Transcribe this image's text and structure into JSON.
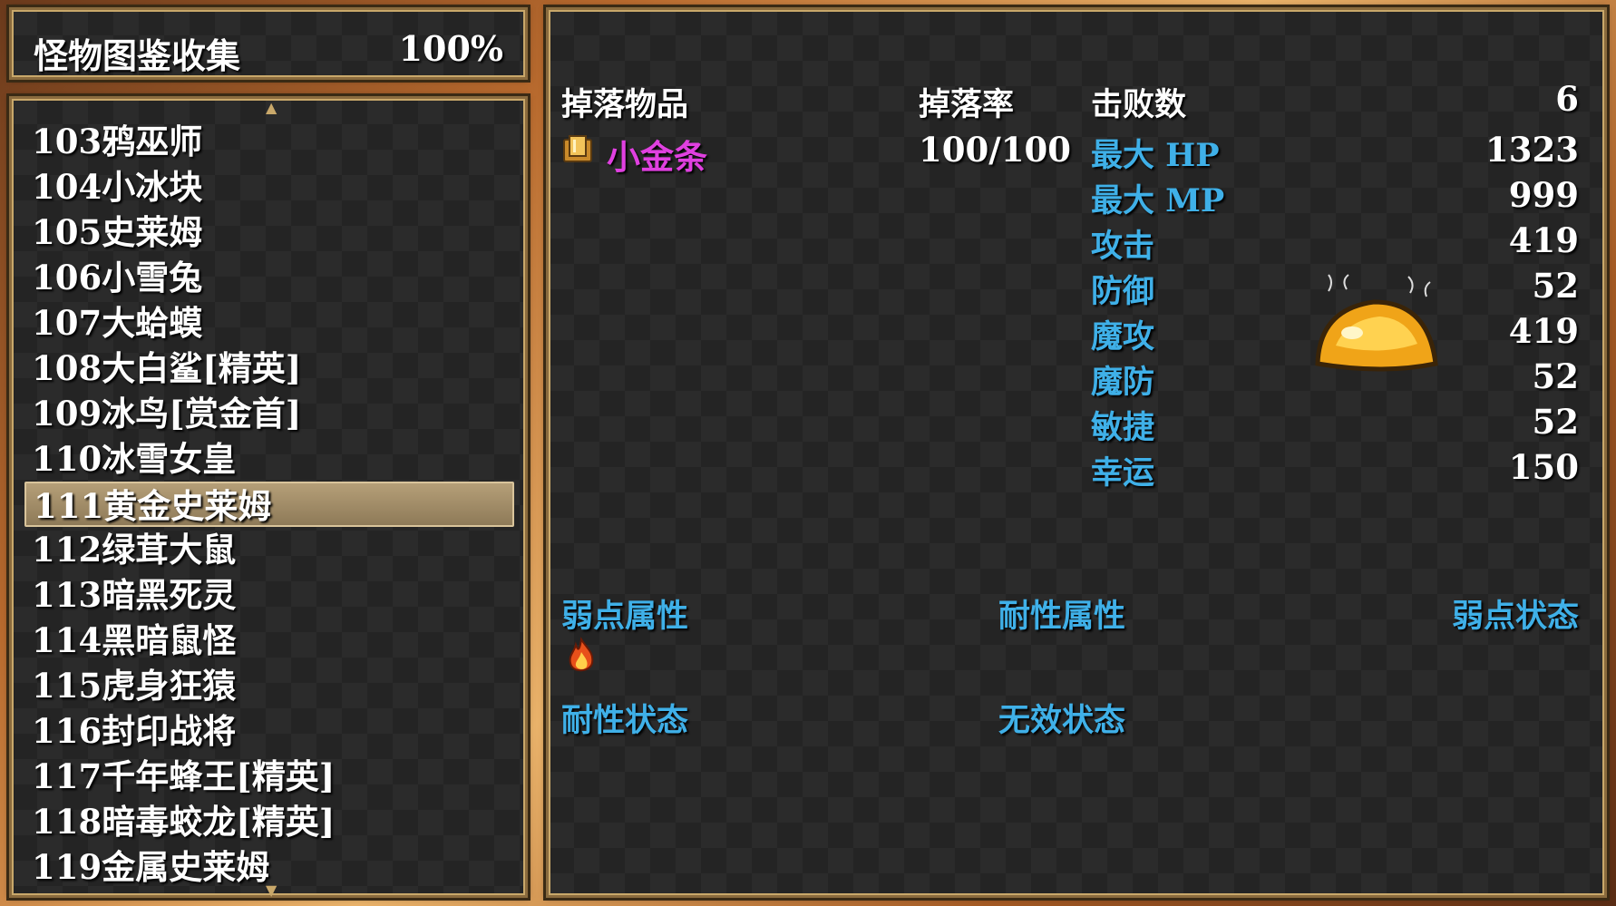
{
  "header": {
    "title": "怪物图鉴收集",
    "completion": "100%"
  },
  "monster_list": {
    "items": [
      {
        "label": "103鸦巫师"
      },
      {
        "label": "104小冰块"
      },
      {
        "label": "105史莱姆"
      },
      {
        "label": "106小雪兔"
      },
      {
        "label": "107大蛤蟆"
      },
      {
        "label": "108大白鲨[精英]"
      },
      {
        "label": "109冰鸟[赏金首]"
      },
      {
        "label": "110冰雪女皇"
      },
      {
        "label": "111黄金史莱姆",
        "selected": true
      },
      {
        "label": "112绿茸大鼠"
      },
      {
        "label": "113暗黑死灵"
      },
      {
        "label": "114黑暗鼠怪"
      },
      {
        "label": "115虎身狂猿"
      },
      {
        "label": "116封印战将"
      },
      {
        "label": "117千年蜂王[精英]"
      },
      {
        "label": "118暗毒蛟龙[精英]"
      },
      {
        "label": "119金属史莱姆"
      }
    ]
  },
  "detail": {
    "drop_header": "掉落物品",
    "rate_header": "掉落率",
    "defeat_header": "击败数",
    "defeat_count": "6",
    "drop_item": {
      "name": "小金条",
      "rate": "100/100",
      "icon": "gold-bar-icon"
    },
    "stats": [
      {
        "label": "最大 HP",
        "value": "1323"
      },
      {
        "label": "最大 MP",
        "value": "999"
      },
      {
        "label": "攻击",
        "value": "419"
      },
      {
        "label": "防御",
        "value": "52"
      },
      {
        "label": "魔攻",
        "value": "419"
      },
      {
        "label": "魔防",
        "value": "52"
      },
      {
        "label": "敏捷",
        "value": "52"
      },
      {
        "label": "幸运",
        "value": "150"
      }
    ],
    "weak_element": "弱点属性",
    "resist_element": "耐性属性",
    "weak_state": "弱点状态",
    "resist_state": "耐性状态",
    "immune_state": "无效状态",
    "weak_element_icons": [
      "fire-icon"
    ]
  },
  "colors": {
    "label_blue": "#3fb0e8",
    "item_purple": "#e040e0",
    "highlight": "#b59f78"
  }
}
